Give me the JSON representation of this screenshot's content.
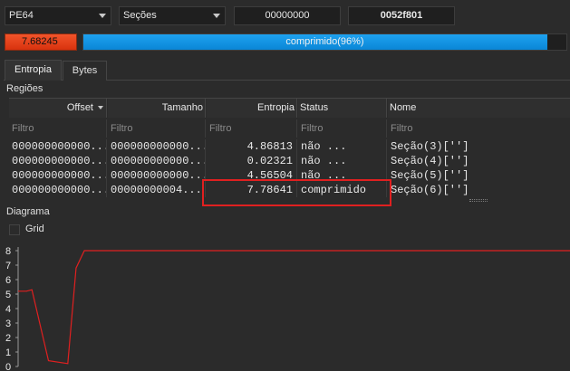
{
  "toolbar": {
    "arch": "PE64",
    "section_select": "Seções",
    "offset_value": "00000000",
    "address_value": "0052f801",
    "entropy_value": "7.68245",
    "progress_label": "comprimido(96%)",
    "progress_fraction": 0.96
  },
  "tabs": [
    {
      "label": "Entropia",
      "active": true
    },
    {
      "label": "Bytes",
      "active": false
    }
  ],
  "regions": {
    "title": "Regiões",
    "columns": [
      "Offset",
      "Tamanho",
      "Entropia",
      "Status",
      "Nome"
    ],
    "filter_placeholder": "Filtro",
    "rows": [
      {
        "offset": "000000000000...",
        "size": "000000000000...",
        "entropy": "4.86813",
        "status": "não ...",
        "name": "Seção(3)['']"
      },
      {
        "offset": "000000000000...",
        "size": "000000000000...",
        "entropy": "0.02321",
        "status": "não ...",
        "name": "Seção(4)['']"
      },
      {
        "offset": "000000000000...",
        "size": "000000000000...",
        "entropy": "4.56504",
        "status": "não ...",
        "name": "Seção(5)['']"
      },
      {
        "offset": "000000000000...",
        "size": "00000000004...",
        "entropy": "7.78641",
        "status": "comprimido",
        "name": "Seção(6)['']"
      }
    ],
    "highlight_color": "#e02020"
  },
  "diagram": {
    "title": "Diagrama",
    "grid_label": "Grid",
    "line_color": "#e02020"
  },
  "chart_data": {
    "type": "line",
    "y_ticks": [
      "0",
      "1",
      "2",
      "3",
      "4",
      "5",
      "6",
      "7",
      "8"
    ],
    "ylim": [
      0,
      8
    ],
    "xlim": [
      0,
      100
    ],
    "grid": false,
    "series": [
      {
        "x": [
          0,
          1.5,
          2.5,
          5.5,
          9,
          10.5,
          12,
          100
        ],
        "values": [
          5.2,
          5.2,
          5.3,
          0.4,
          0.2,
          6.8,
          8.0,
          8.0
        ]
      }
    ]
  }
}
